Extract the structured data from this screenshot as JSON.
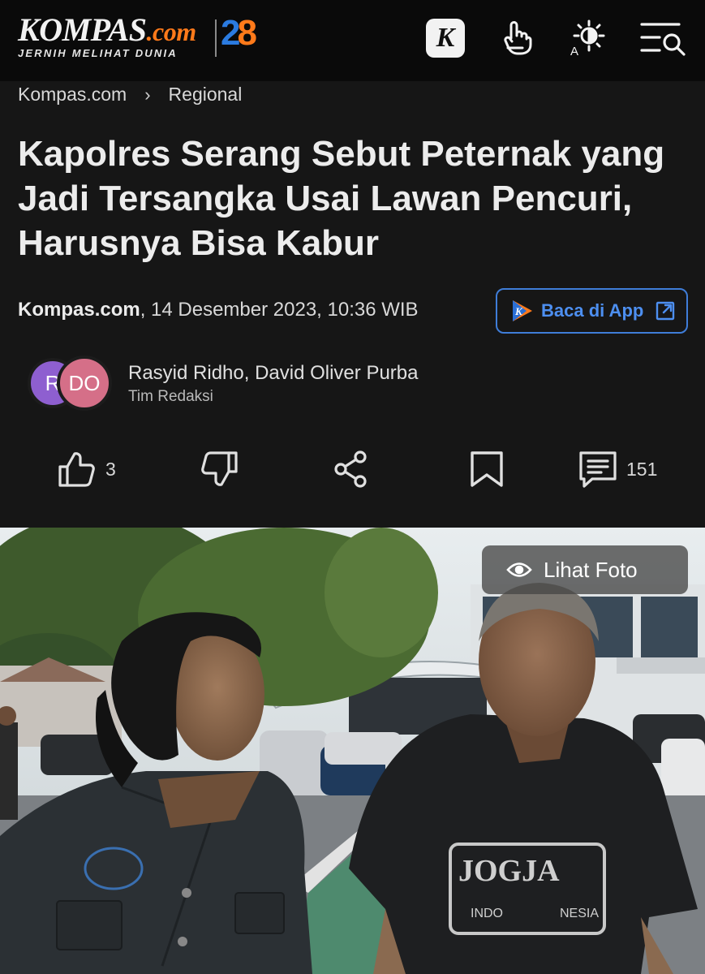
{
  "header": {
    "logo_text": "KOMPAS",
    "logo_suffix": ".com",
    "tagline": "JERNIH MELIHAT DUNIA",
    "anniversary_digit1": "2",
    "anniversary_digit2": "8",
    "k_badge": "K"
  },
  "breadcrumb": {
    "home": "Kompas.com",
    "separator": "›",
    "section": "Regional"
  },
  "article": {
    "title": "Kapolres Serang Sebut Peternak yang Jadi Tersangka Usai Lawan Pencuri, Harusnya Bisa Kabur",
    "source": "Kompas.com",
    "date": ", 14 Desember 2023, 10:36 WIB",
    "app_button": "Baca di App",
    "app_logo_letter": "K"
  },
  "authors": {
    "avatar1": "R",
    "avatar2": "DO",
    "names": "Rasyid Ridho, David Oliver Purba",
    "team": "Tim Redaksi"
  },
  "actions": {
    "like_count": "3",
    "comment_count": "151"
  },
  "photo": {
    "view_label": "Lihat Foto",
    "shirt_text_1": "JOGJA",
    "shirt_text_2": "INDO",
    "shirt_text_3": "NESIA"
  },
  "colors": {
    "accent_blue": "#3f7dd8",
    "brand_orange": "#ff7a1a",
    "background": "#161616"
  }
}
